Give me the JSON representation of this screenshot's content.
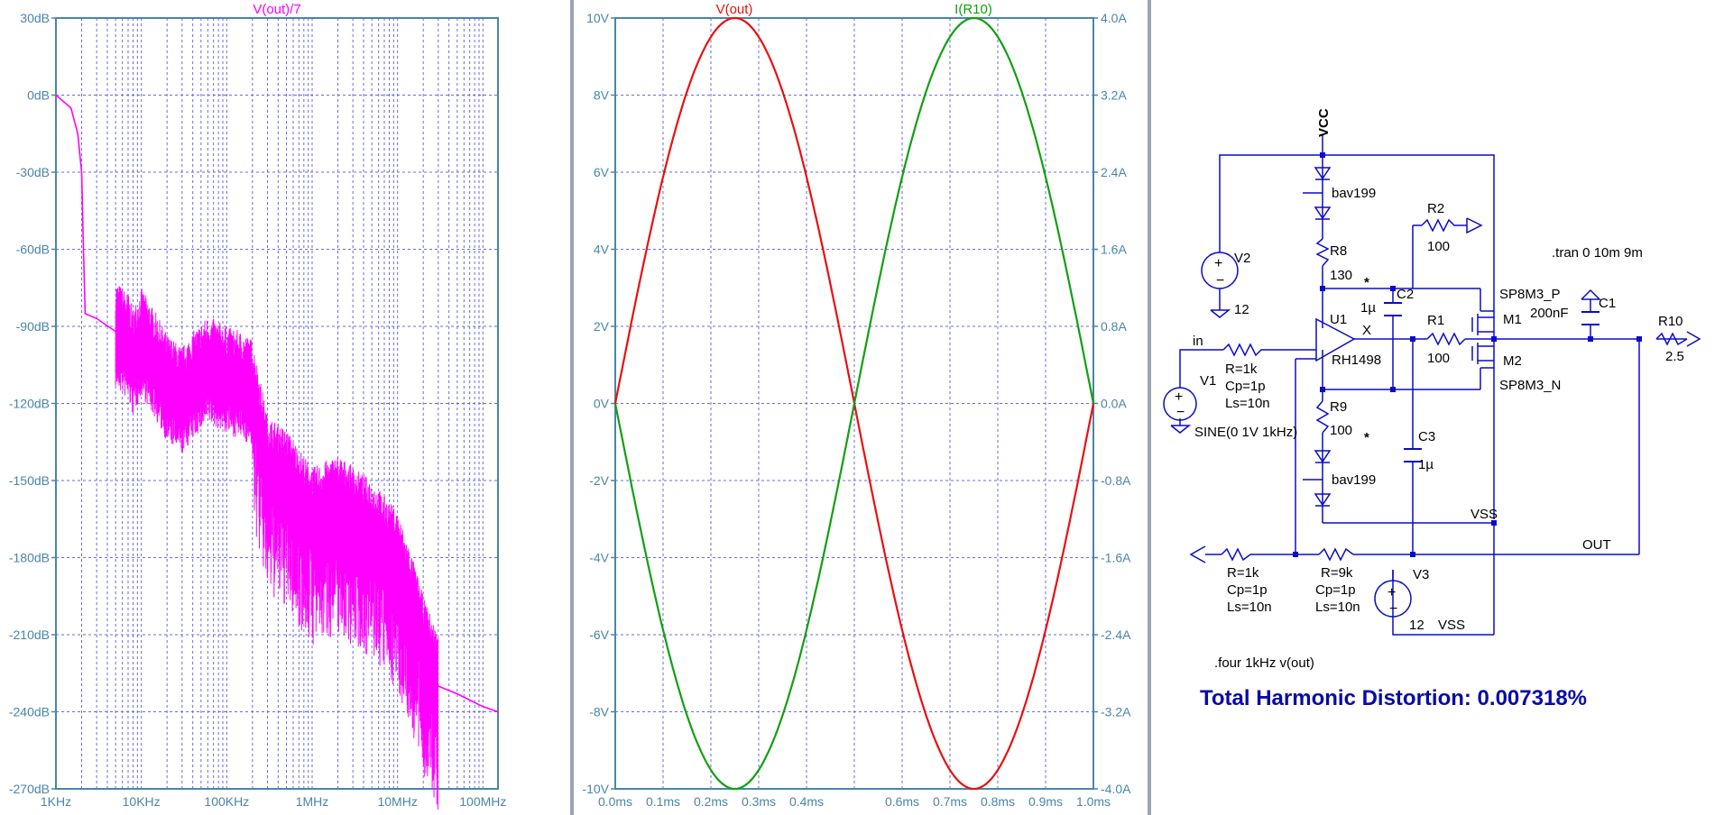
{
  "colors": {
    "axis": "#4a86a8",
    "grid": "#6a6ae8",
    "spectrum": "#ff00ff",
    "vout": "#e81010",
    "ir10": "#10a010",
    "wire": "#0b0bc8",
    "thd": "#0a0aa8"
  },
  "plots": {
    "fft": {
      "title": "V(out)/7",
      "y_ticks": [
        "30dB",
        "0dB",
        "-30dB",
        "-60dB",
        "-90dB",
        "-120dB",
        "-150dB",
        "-180dB",
        "-210dB",
        "-240dB",
        "-270dB"
      ],
      "x_ticks": [
        "1KHz",
        "10KHz",
        "100KHz",
        "1MHz",
        "10MHz",
        "100MHz"
      ]
    },
    "transient": {
      "title_left": "V(out)",
      "title_right": "I(R10)",
      "y_left_ticks": [
        "10V",
        "8V",
        "6V",
        "4V",
        "2V",
        "0V",
        "-2V",
        "-4V",
        "-6V",
        "-8V",
        "-10V"
      ],
      "y_right_ticks": [
        "4.0A",
        "3.2A",
        "2.4A",
        "1.6A",
        "0.8A",
        "0.0A",
        "-0.8A",
        "-1.6A",
        "-2.4A",
        "-3.2A",
        "-4.0A"
      ],
      "x_ticks": [
        "0.0ms",
        "0.1ms",
        "0.2ms",
        "0.3ms",
        "0.4ms",
        "0.6ms",
        "0.7ms",
        "0.8ms",
        "0.9ms",
        "1.0ms"
      ]
    }
  },
  "chart_data": [
    {
      "type": "line",
      "title": "V(out)/7",
      "x_scale": "log",
      "xlim": [
        1000,
        150000000
      ],
      "ylim": [
        -270,
        30
      ],
      "y_unit": "dB",
      "grid": true,
      "series": [
        {
          "name": "V(out)/7",
          "color": "#ff00ff",
          "x": [
            1000,
            1500,
            1800,
            2000,
            2100,
            2200,
            3000,
            5000,
            7000,
            8000,
            10000,
            15000,
            20000,
            30000,
            40000,
            60000,
            80000,
            100000,
            150000,
            200000,
            300000,
            500000,
            1000000,
            2000000,
            5000000,
            10000000,
            15000000,
            20000000,
            30000000,
            50000000,
            100000000,
            150000000
          ],
          "y": [
            0,
            -5,
            -15,
            -30,
            -60,
            -85,
            -87,
            -92,
            -97,
            -103,
            -95,
            -105,
            -113,
            -118,
            -112,
            -106,
            -108,
            -110,
            -112,
            -115,
            -145,
            -150,
            -165,
            -160,
            -170,
            -182,
            -200,
            -215,
            -230,
            -233,
            -238,
            -240
          ]
        }
      ]
    },
    {
      "type": "line",
      "title": "",
      "xlabel": "",
      "xlim": [
        0.0,
        1.0
      ],
      "ylim": [
        -10,
        10
      ],
      "ylim_right": [
        -4.0,
        4.0
      ],
      "x_unit": "ms",
      "grid": true,
      "series": [
        {
          "name": "V(out)",
          "axis": "left",
          "color": "#e81010",
          "x": [
            0.0,
            0.05,
            0.1,
            0.15,
            0.2,
            0.25,
            0.3,
            0.35,
            0.4,
            0.45,
            0.5,
            0.55,
            0.6,
            0.65,
            0.7,
            0.75,
            0.8,
            0.85,
            0.9,
            0.95,
            1.0
          ],
          "y": [
            0.0,
            3.09,
            5.88,
            8.09,
            9.51,
            10.0,
            9.51,
            8.09,
            5.88,
            3.09,
            0.0,
            -3.09,
            -5.88,
            -8.09,
            -9.51,
            -10.0,
            -9.51,
            -8.09,
            -5.88,
            -3.09,
            0.0
          ]
        },
        {
          "name": "I(R10)",
          "axis": "right",
          "color": "#10a010",
          "x": [
            0.0,
            0.05,
            0.1,
            0.15,
            0.2,
            0.25,
            0.3,
            0.35,
            0.4,
            0.45,
            0.5,
            0.55,
            0.6,
            0.65,
            0.7,
            0.75,
            0.8,
            0.85,
            0.9,
            0.95,
            1.0
          ],
          "y": [
            0.0,
            -1.24,
            -2.35,
            -3.24,
            -3.8,
            -4.0,
            -3.8,
            -3.24,
            -2.35,
            -1.24,
            0.0,
            1.24,
            2.35,
            3.24,
            3.8,
            4.0,
            3.8,
            3.24,
            2.35,
            1.24,
            0.0
          ]
        }
      ]
    }
  ],
  "schematic": {
    "vcc": "VCC",
    "vss_top": "VSS",
    "vss_bottom": "VSS",
    "out_label": "OUT",
    "in_label": "in",
    "x_label": "X",
    "bav_top": "bav199",
    "bav_bottom": "bav199",
    "r8_name": "R8",
    "r8_value": "130",
    "r9_name": "R9",
    "r9_value": "100",
    "r2_name": "R2",
    "r2_value": "100",
    "r1_name": "R1",
    "r1_value": "100",
    "r10_name": "R10",
    "r10_value": "2.5",
    "c1_name": "C1",
    "c1_value": "200nF",
    "c2_name": "C2",
    "c2_value": "1µ",
    "c3_name": "C3",
    "c3_value": "1µ",
    "u1_name": "U1",
    "u1_model": "RH1498",
    "m1_name": "M1",
    "m1_model": "SP8M3_P",
    "m2_name": "M2",
    "m2_model": "SP8M3_N",
    "v1_name": "V1",
    "v1_value": "SINE(0 1V 1kHz)",
    "v2_name": "V2",
    "v2_value": "12",
    "v3_name": "V3",
    "v3_value": "12",
    "rin_r": "R=1k",
    "rin_cp": "Cp=1p",
    "rin_ls": "Ls=10n",
    "rfb1_r": "R=1k",
    "rfb1_cp": "Cp=1p",
    "rfb1_ls": "Ls=10n",
    "rfb2_r": "R=9k",
    "rfb2_cp": "Cp=1p",
    "rfb2_ls": "Ls=10n",
    "star_top": "*",
    "star_bottom": "*",
    "tran_directive": ".tran 0 10m 9m",
    "four_directive": ".four 1kHz v(out)",
    "thd_text": "Total Harmonic Distortion: 0.007318%"
  }
}
